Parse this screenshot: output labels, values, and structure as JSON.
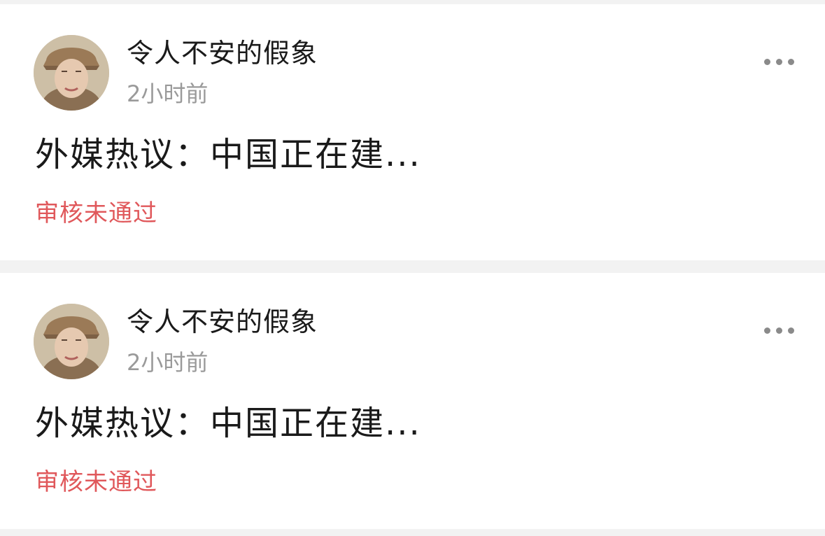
{
  "posts": [
    {
      "author": "令人不安的假象",
      "time": "2小时前",
      "title": "外媒热议：中国正在建...",
      "status": "审核未通过",
      "more_icon": "more-horizontal-icon"
    },
    {
      "author": "令人不安的假象",
      "time": "2小时前",
      "title": "外媒热议：中国正在建...",
      "status": "审核未通过",
      "more_icon": "more-horizontal-icon"
    }
  ],
  "colors": {
    "background": "#f2f2f2",
    "card": "#ffffff",
    "text_primary": "#1a1a1a",
    "text_secondary": "#9a9a9a",
    "status_rejected": "#e0585b",
    "icon": "#8a8a8a"
  }
}
